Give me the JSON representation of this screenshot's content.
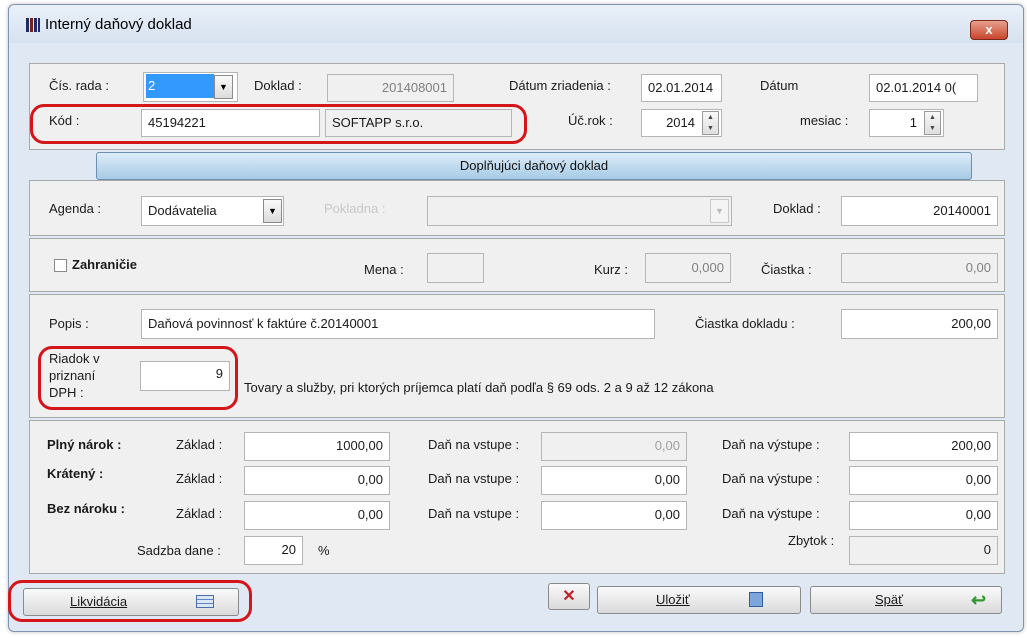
{
  "window": {
    "title": "Interný daňový doklad",
    "close": "x"
  },
  "header": {
    "cis_rada_label": "Čís. rada :",
    "cis_rada_value": "2",
    "doklad_label": "Doklad :",
    "doklad_value": "201408001",
    "datum_zriadenia_label": "Dátum zriadenia :",
    "datum_zriadenia_value": "02.01.2014",
    "datum_label": "Dátum",
    "datum_value": "02.01.2014 0(",
    "kod_label": "Kód :",
    "kod_value": "45194221",
    "company_value": "SOFTAPP s.r.o.",
    "uc_rok_label": "Úč.rok :",
    "uc_rok_value": "2014",
    "mesiac_label": "mesiac :",
    "mesiac_value": "1"
  },
  "section_title": "Doplňujúci daňový doklad",
  "agenda": {
    "agenda_label": "Agenda :",
    "agenda_value": "Dodávatelia",
    "pokladna_label": "Pokladna :",
    "pokladna_value": "",
    "doklad_label": "Doklad :",
    "doklad_value": "20140001"
  },
  "foreign": {
    "zahranicie_label": "Zahraničie",
    "mena_label": "Mena :",
    "mena_value": "",
    "kurz_label": "Kurz :",
    "kurz_value": "0,000",
    "ciastka_label": "Čiastka :",
    "ciastka_value": "0,00"
  },
  "popis": {
    "popis_label": "Popis :",
    "popis_value": "Daňová povinnosť k faktúre č.20140001",
    "ciastka_dokladu_label": "Čiastka dokladu :",
    "ciastka_dokladu_value": "200,00",
    "riadok_label_1": "Riadok v",
    "riadok_label_2": "priznaní",
    "riadok_label_3": "DPH :",
    "riadok_value": "9",
    "riadok_desc": "Tovary a služby, pri ktorých príjemca platí daň podľa § 69 ods. 2 a 9 až 12 zákona"
  },
  "tax": {
    "rows": [
      {
        "name": "Plný nárok :",
        "zaklad_label": "Základ :",
        "zaklad": "1000,00",
        "vstup_label": "Daň na vstupe :",
        "vstup": "0,00",
        "vystup_label": "Daň na výstupe :",
        "vystup": "200,00"
      },
      {
        "name": "Krátený :",
        "zaklad_label": "Základ :",
        "zaklad": "0,00",
        "vstup_label": "Daň na vstupe :",
        "vstup": "0,00",
        "vystup_label": "Daň na výstupe :",
        "vystup": "0,00"
      },
      {
        "name": "Bez nároku :",
        "zaklad_label": "Základ :",
        "zaklad": "0,00",
        "vstup_label": "Daň na vstupe :",
        "vstup": "0,00",
        "vystup_label": "Daň na výstupe :",
        "vystup": "0,00"
      }
    ],
    "sadzba_label": "Sadzba dane :",
    "sadzba_value": "20",
    "percent": "%",
    "zbytok_label": "Zbytok :",
    "zbytok_value": "0"
  },
  "buttons": {
    "likvidacia": "Likvidácia",
    "ulozit": "Uložiť",
    "spat": "Späť"
  },
  "colors": {
    "highlight": "#d4161b",
    "section_bar": "#a7cbe6",
    "selection": "#3399ff"
  },
  "icons": [
    "app-icon",
    "close-icon",
    "dropdown-arrow-icon",
    "spin-icon",
    "checkbox-icon",
    "list-icon",
    "delete-icon",
    "save-icon",
    "back-arrow-icon"
  ]
}
